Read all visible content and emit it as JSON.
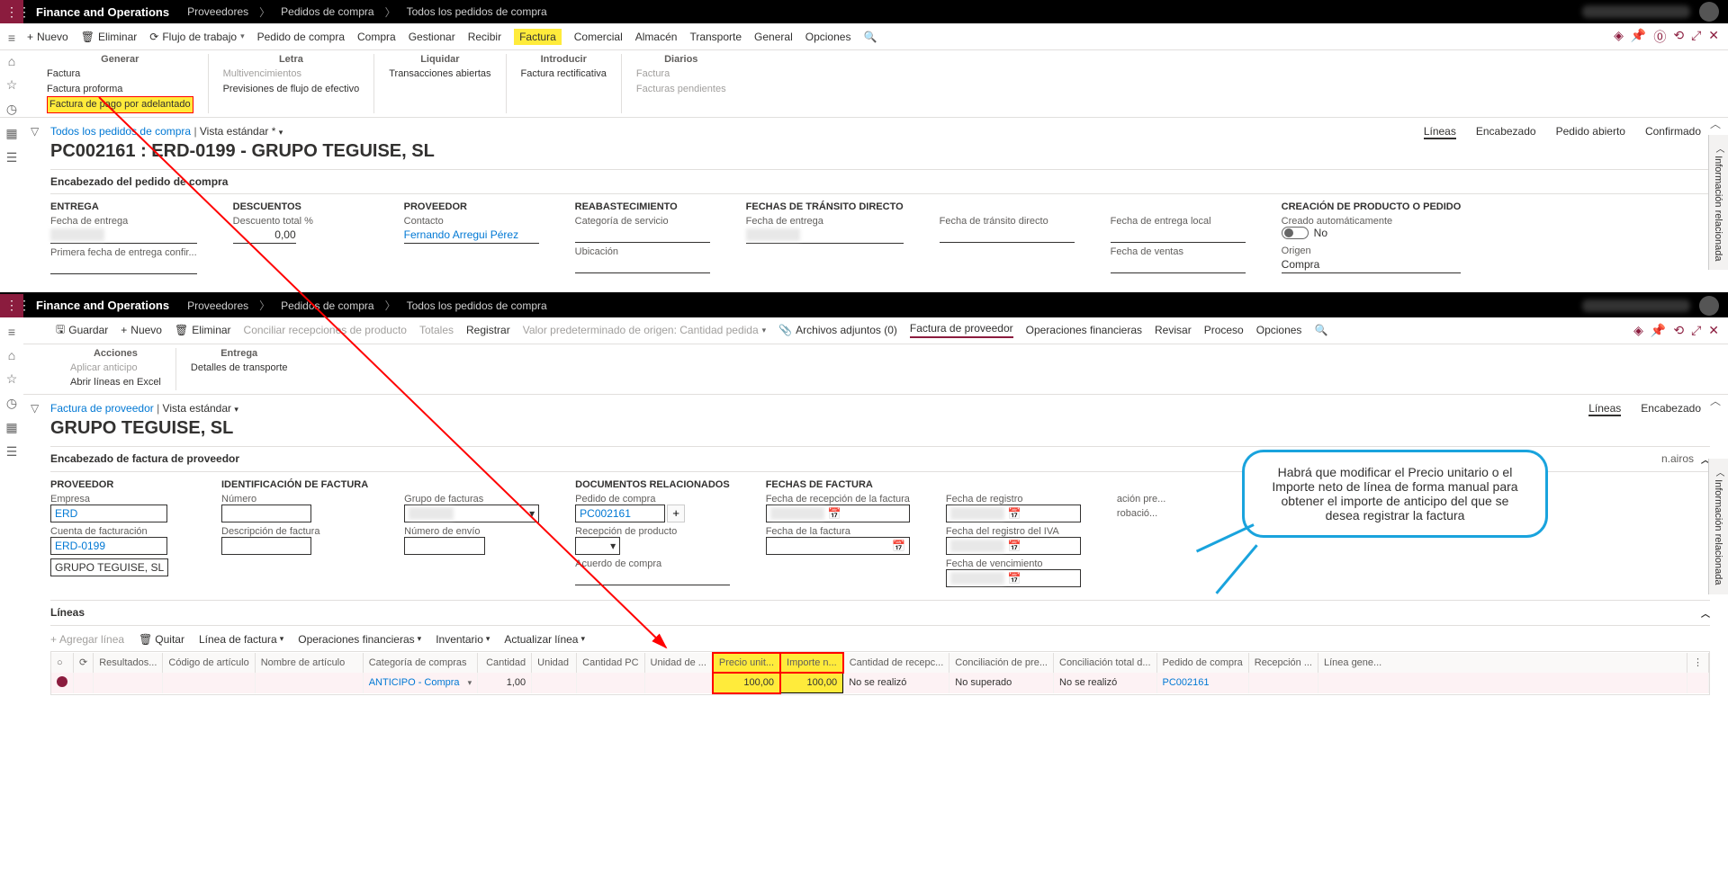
{
  "app": {
    "title": "Finance and Operations"
  },
  "breadcrumb": [
    "Proveedores",
    "Pedidos de compra",
    "Todos los pedidos de compra"
  ],
  "cmd1": {
    "new": "Nuevo",
    "delete": "Eliminar",
    "workflow": "Flujo de trabajo",
    "po": "Pedido de compra",
    "purchase": "Compra",
    "manage": "Gestionar",
    "receive": "Recibir",
    "invoice": "Factura",
    "commercial": "Comercial",
    "warehouse": "Almacén",
    "transport": "Transporte",
    "general": "General",
    "options": "Opciones"
  },
  "ribbon": {
    "groups": [
      {
        "title": "Generar",
        "items": [
          {
            "t": "Factura"
          },
          {
            "t": "Factura proforma"
          },
          {
            "t": "Factura de pago por adelantado",
            "hl": true
          }
        ]
      },
      {
        "title": "Letra",
        "items": [
          {
            "t": "Multivencimientos",
            "g": true
          },
          {
            "t": "Previsiones de flujo de efectivo"
          }
        ]
      },
      {
        "title": "Liquidar",
        "items": [
          {
            "t": "Transacciones abiertas"
          }
        ]
      },
      {
        "title": "Introducir",
        "items": [
          {
            "t": "Factura rectificativa"
          }
        ]
      },
      {
        "title": "Diarios",
        "items": [
          {
            "t": "Factura",
            "g": true
          },
          {
            "t": "Facturas pendientes",
            "g": true
          }
        ]
      }
    ]
  },
  "page1": {
    "bc_link": "Todos los pedidos de compra",
    "bc_view": "Vista estándar *",
    "title": "PC002161 : ERD-0199 - GRUPO TEGUISE, SL",
    "tabs": [
      "Líneas",
      "Encabezado",
      "Pedido abierto",
      "Confirmado"
    ],
    "section": "Encabezado del pedido de compra",
    "entrega": {
      "h": "ENTREGA",
      "f1": "Fecha de entrega",
      "f2": "Primera fecha de entrega confir..."
    },
    "desc": {
      "h": "DESCUENTOS",
      "f1": "Descuento total %",
      "v1": "0,00"
    },
    "prov": {
      "h": "PROVEEDOR",
      "f1": "Contacto",
      "v1": "Fernando Arregui Pérez"
    },
    "reab": {
      "h": "REABASTECIMIENTO",
      "f1": "Categoría de servicio",
      "f2": "Ubicación"
    },
    "ftd": {
      "h": "FECHAS DE TRÁNSITO DIRECTO",
      "f1": "Fecha de entrega"
    },
    "ftd2": {
      "f1": "Fecha de tránsito directo"
    },
    "fel": {
      "f1": "Fecha de entrega local",
      "f2": "Fecha de ventas"
    },
    "cp": {
      "h": "CREACIÓN DE PRODUCTO O PEDIDO",
      "f1": "Creado automáticamente",
      "v1": "No",
      "f2": "Origen",
      "v2": "Compra"
    }
  },
  "cmd2": {
    "save": "Guardar",
    "new": "Nuevo",
    "delete": "Eliminar",
    "match": "Conciliar recepciones de producto",
    "totals": "Totales",
    "register": "Registrar",
    "default": "Valor predeterminado de origen: Cantidad pedida",
    "attach": "Archivos adjuntos (0)",
    "vinvoice": "Factura de proveedor",
    "finops": "Operaciones financieras",
    "review": "Revisar",
    "process": "Proceso",
    "options": "Opciones"
  },
  "ribbon2": {
    "g1": "Acciones",
    "i1": "Aplicar anticipo",
    "i2": "Abrir líneas en Excel",
    "g2": "Entrega",
    "i3": "Detalles de transporte"
  },
  "page2": {
    "bc_link": "Factura de proveedor",
    "bc_view": "Vista estándar",
    "title": "GRUPO TEGUISE, SL",
    "tabs": [
      "Líneas",
      "Encabezado"
    ],
    "section": "Encabezado de factura de proveedor",
    "user": "n.airos",
    "prov": {
      "h": "PROVEEDOR",
      "f1": "Empresa",
      "v1": "ERD",
      "f2": "Cuenta de facturación",
      "v2": "ERD-0199",
      "v3": "GRUPO TEGUISE, SL"
    },
    "idf": {
      "h": "IDENTIFICACIÓN DE FACTURA",
      "f1": "Número",
      "f2": "Descripción de factura"
    },
    "grp": {
      "f1": "Grupo de facturas",
      "f2": "Número de envío"
    },
    "doc": {
      "h": "DOCUMENTOS RELACIONADOS",
      "f1": "Pedido de compra",
      "v1": "PC002161",
      "f2": "Recepción de producto",
      "f3": "Acuerdo de compra"
    },
    "ff": {
      "h": "FECHAS DE FACTURA",
      "f1": "Fecha de recepción de la factura",
      "f2": "Fecha de la factura"
    },
    "ff2": {
      "f1": "Fecha de registro",
      "f2": "Fecha del registro del IVA",
      "f3": "Fecha de vencimiento"
    },
    "ff3": {
      "f1": "ación pre...",
      "f2": "robació..."
    },
    "lines": "Líneas",
    "toolbar": {
      "add": "Agregar línea",
      "remove": "Quitar",
      "invline": "Línea de factura",
      "finops": "Operaciones financieras",
      "inv": "Inventario",
      "update": "Actualizar línea"
    },
    "cols": [
      "",
      "",
      "Resultados...",
      "Código de artículo",
      "Nombre de artículo",
      "Categoría de compras",
      "Cantidad",
      "Unidad",
      "Cantidad PC",
      "Unidad de ...",
      "Precio unit...",
      "Importe n...",
      "Cantidad de recepc...",
      "Conciliación de pre...",
      "Conciliación total d...",
      "Pedido de compra",
      "Recepción ...",
      "Línea gene..."
    ],
    "row": {
      "cat": "ANTICIPO - Compra",
      "qty": "1,00",
      "price": "100,00",
      "amount": "100,00",
      "m1": "No se realizó",
      "m2": "No superado",
      "m3": "No se realizó",
      "po": "PC002161"
    }
  },
  "callout": "Habrá que modificar el Precio unitario o el Importe neto de línea de forma manual para obtener el importe de anticipo del que se desea registrar la factura",
  "side": "Información relacionada"
}
